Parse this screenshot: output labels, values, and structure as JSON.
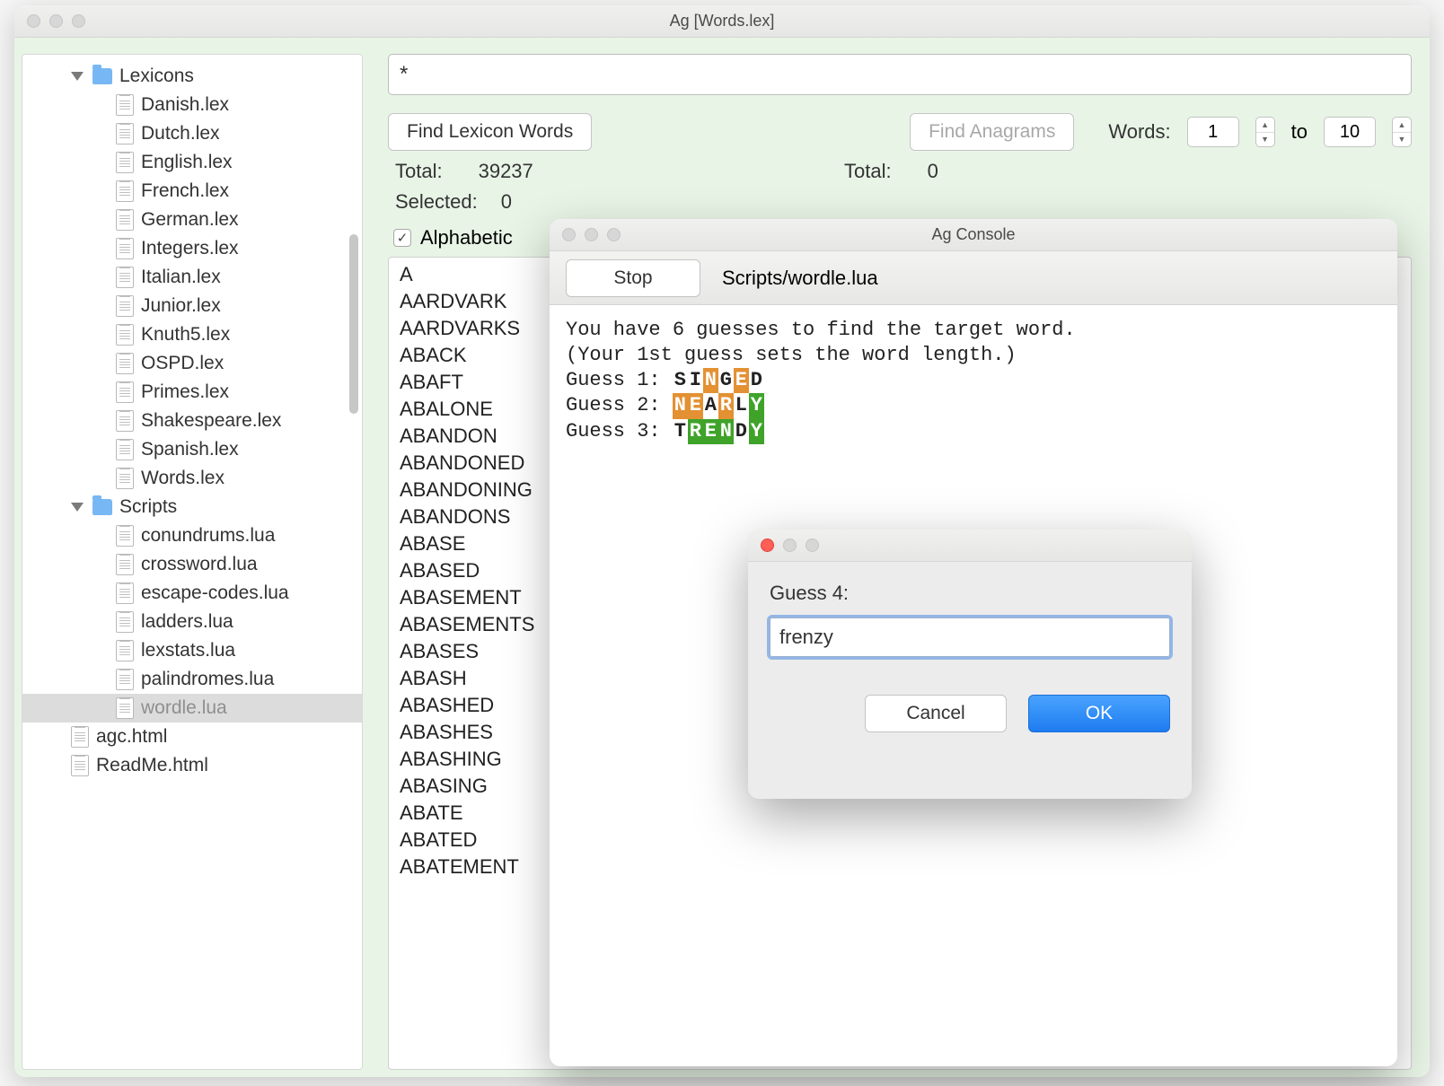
{
  "main_window": {
    "title": "Ag [Words.lex]"
  },
  "sidebar": {
    "folders": [
      {
        "name": "Lexicons",
        "items": [
          "Danish.lex",
          "Dutch.lex",
          "English.lex",
          "French.lex",
          "German.lex",
          "Integers.lex",
          "Italian.lex",
          "Junior.lex",
          "Knuth5.lex",
          "OSPD.lex",
          "Primes.lex",
          "Shakespeare.lex",
          "Spanish.lex",
          "Words.lex"
        ]
      },
      {
        "name": "Scripts",
        "items": [
          "conundrums.lua",
          "crossword.lua",
          "escape-codes.lua",
          "ladders.lua",
          "lexstats.lua",
          "palindromes.lua",
          "wordle.lua"
        ]
      }
    ],
    "root_files": [
      "agc.html",
      "ReadMe.html"
    ],
    "selected": "wordle.lua"
  },
  "search": {
    "value": "*"
  },
  "buttons": {
    "find_lexicon": "Find Lexicon Words",
    "find_anagrams": "Find Anagrams"
  },
  "words_controls": {
    "label_words": "Words:",
    "from": "1",
    "to_label": "to",
    "to": "10"
  },
  "totals": {
    "left_label": "Total:",
    "left_value": "39237",
    "sel_label": "Selected:",
    "sel_value": "0",
    "right_label": "Total:",
    "right_value": "0"
  },
  "alphabetic_label": "Alphabetic",
  "alphabetic_checked": true,
  "word_list": [
    "A",
    "AARDVARK",
    "AARDVARKS",
    "ABACK",
    "ABAFT",
    "ABALONE",
    "ABANDON",
    "ABANDONED",
    "ABANDONING",
    "ABANDONS",
    "ABASE",
    "ABASED",
    "ABASEMENT",
    "ABASEMENTS",
    "ABASES",
    "ABASH",
    "ABASHED",
    "ABASHES",
    "ABASHING",
    "ABASING",
    "ABATE",
    "ABATED",
    "ABATEMENT"
  ],
  "console": {
    "title": "Ag Console",
    "stop_label": "Stop",
    "script_path": "Scripts/wordle.lua",
    "intro1": "You have 6 guesses to find the target word.",
    "intro2": "(Your 1st guess sets the word length.)",
    "guesses": [
      {
        "label": "Guess 1: ",
        "letters": [
          {
            "c": "S",
            "s": "plain"
          },
          {
            "c": "I",
            "s": "plain"
          },
          {
            "c": "N",
            "s": "orange"
          },
          {
            "c": "G",
            "s": "plain"
          },
          {
            "c": "E",
            "s": "orange"
          },
          {
            "c": "D",
            "s": "plain"
          }
        ]
      },
      {
        "label": "Guess 2: ",
        "letters": [
          {
            "c": "N",
            "s": "orange"
          },
          {
            "c": "E",
            "s": "orange"
          },
          {
            "c": "A",
            "s": "plain"
          },
          {
            "c": "R",
            "s": "orange"
          },
          {
            "c": "L",
            "s": "plain"
          },
          {
            "c": "Y",
            "s": "green"
          }
        ]
      },
      {
        "label": "Guess 3: ",
        "letters": [
          {
            "c": "T",
            "s": "plain"
          },
          {
            "c": "R",
            "s": "green"
          },
          {
            "c": "E",
            "s": "green"
          },
          {
            "c": "N",
            "s": "green"
          },
          {
            "c": "D",
            "s": "plain"
          },
          {
            "c": "Y",
            "s": "green"
          }
        ]
      }
    ]
  },
  "dialog": {
    "label": "Guess 4:",
    "input_value": "frenzy",
    "cancel": "Cancel",
    "ok": "OK"
  }
}
